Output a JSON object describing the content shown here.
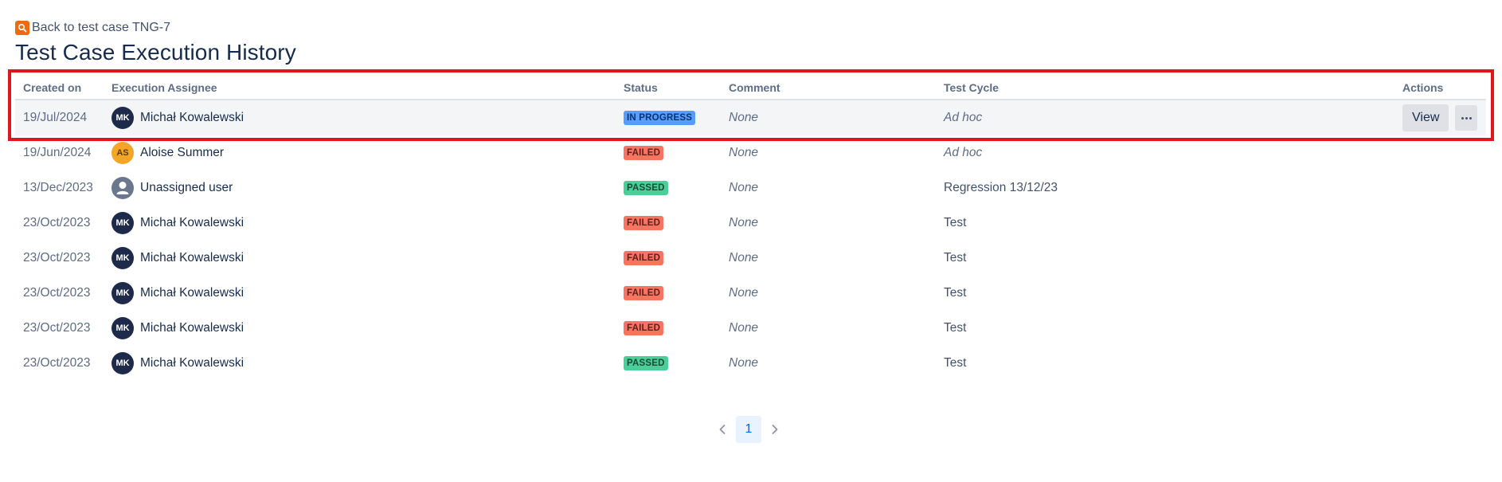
{
  "back_link": {
    "label": "Back to test case TNG-7",
    "icon": "search-icon"
  },
  "page_title": "Test Case Execution History",
  "columns": [
    "Created on",
    "Execution Assignee",
    "Status",
    "Comment",
    "Test Cycle",
    "Actions"
  ],
  "rows": [
    {
      "created": "19/Jul/2024",
      "avatar": "MK",
      "assignee": "Michał Kowalewski",
      "status": "IN PROGRESS",
      "comment": "None",
      "cycle": "Ad hoc"
    },
    {
      "created": "19/Jun/2024",
      "avatar": "AS",
      "assignee": "Aloise Summer",
      "status": "FAILED",
      "comment": "None",
      "cycle": "Ad hoc"
    },
    {
      "created": "13/Dec/2023",
      "avatar": "",
      "assignee": "Unassigned user",
      "status": "PASSED",
      "comment": "None",
      "cycle": "Regression 13/12/23"
    },
    {
      "created": "23/Oct/2023",
      "avatar": "MK",
      "assignee": "Michał Kowalewski",
      "status": "FAILED",
      "comment": "None",
      "cycle": "Test"
    },
    {
      "created": "23/Oct/2023",
      "avatar": "MK",
      "assignee": "Michał Kowalewski",
      "status": "FAILED",
      "comment": "None",
      "cycle": "Test"
    },
    {
      "created": "23/Oct/2023",
      "avatar": "MK",
      "assignee": "Michał Kowalewski",
      "status": "FAILED",
      "comment": "None",
      "cycle": "Test"
    },
    {
      "created": "23/Oct/2023",
      "avatar": "MK",
      "assignee": "Michał Kowalewski",
      "status": "FAILED",
      "comment": "None",
      "cycle": "Test"
    },
    {
      "created": "23/Oct/2023",
      "avatar": "MK",
      "assignee": "Michał Kowalewski",
      "status": "PASSED",
      "comment": "None",
      "cycle": "Test"
    }
  ],
  "actions": {
    "view_label": "View",
    "more_icon": "more-horizontal-icon"
  },
  "pagination": {
    "current_page": "1",
    "prev_icon": "chevron-left-icon",
    "next_icon": "chevron-right-icon"
  },
  "colors": {
    "in_progress": "#579dff",
    "failed": "#f87462",
    "passed": "#4bce97",
    "highlight": "#e0161d",
    "accent": "#f16a0c"
  }
}
